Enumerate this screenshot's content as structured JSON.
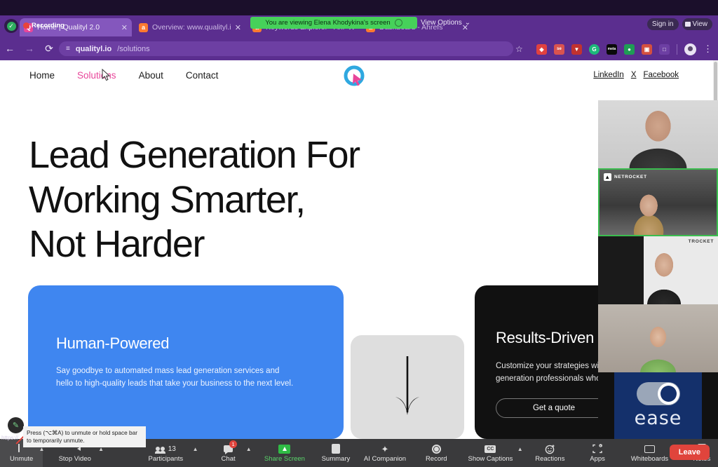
{
  "browser": {
    "recording_label": "Recording",
    "signin_label": "Sign in",
    "view_label": "View",
    "tabs": [
      {
        "title": "Home | Qualityl 2.0",
        "favicon": "Q",
        "favicon_color": "#e8469a",
        "active": true
      },
      {
        "title": "Overview: www.qualityl.io/ - Ah",
        "favicon": "a",
        "favicon_color": "#ff7a2f",
        "active": false
      },
      {
        "title": "Keywords Explorer - Ahrefs",
        "favicon": "a",
        "favicon_color": "#ff7a2f",
        "active": false
      },
      {
        "title": "Dashboard - Ahrefs",
        "favicon": "a",
        "favicon_color": "#ff7a2f",
        "active": false
      }
    ],
    "new_tab_glyph": "+",
    "close_glyph": "✕",
    "back_glyph": "←",
    "forward_glyph": "→",
    "reload_glyph": "⟳",
    "url_host": "qualityl.io",
    "url_path": "/solutions",
    "star_glyph": "☆",
    "kebab_glyph": "⋮",
    "extensions": [
      {
        "name": "diamond-extension-icon",
        "glyph": "◆",
        "color": "#e0413f"
      },
      {
        "name": "seo-extension-icon",
        "glyph": "se",
        "color": "#d9534f"
      },
      {
        "name": "shield-extension-icon",
        "glyph": "▼",
        "color": "#c2322f"
      },
      {
        "name": "grammarly-extension-icon",
        "glyph": "G",
        "color": "#1db87a"
      },
      {
        "name": "meta-extension-icon",
        "glyph": "meta",
        "color": "#0a0a0a"
      },
      {
        "name": "clip-extension-icon",
        "glyph": "●",
        "color": "#1f9d55"
      },
      {
        "name": "gallery-extension-icon",
        "glyph": "▣",
        "color": "#d4503f"
      },
      {
        "name": "bag-extension-icon",
        "glyph": "□",
        "color": "#6d3fa3"
      }
    ]
  },
  "share_banner": {
    "text": "You are viewing Elena Khodykina's screen",
    "view_options_label": "View Options",
    "chevron": "⌄"
  },
  "site": {
    "nav": [
      {
        "label": "Home",
        "active": false
      },
      {
        "label": "Solutions",
        "active": true
      },
      {
        "label": "About",
        "active": false
      },
      {
        "label": "Contact",
        "active": false
      }
    ],
    "social": [
      "LinkedIn",
      "X",
      "Facebook"
    ],
    "hero": {
      "line1": "Lead Generation For",
      "line2": "Working Smarter,",
      "line3": "Not Harder"
    },
    "cards": {
      "blue": {
        "title": "Human-Powered",
        "body_line1": "Say goodbye to automated mass lead generation services and",
        "body_line2": "hello to high-quality leads that take your business to the next level.",
        "color": "#3f86f0"
      },
      "grey": {
        "arrow_glyph": "↓",
        "color": "#dedede"
      },
      "dark": {
        "title": "Results-Driven",
        "body_line1": "Customize your strategies with a",
        "body_line2": "generation professionals who bri",
        "button_label": "Get a quote",
        "color": "#111111"
      }
    }
  },
  "zoom_call": {
    "tiles": [
      {
        "name": "participant-tile-1",
        "badge": ""
      },
      {
        "name": "participant-tile-2",
        "badge": "NETROCKET",
        "speaking": true
      },
      {
        "name": "participant-tile-3",
        "badge": "TROCKET"
      },
      {
        "name": "participant-tile-4",
        "badge": ""
      },
      {
        "name": "participant-tile-5",
        "badge": "ease"
      }
    ],
    "brand_tile_text": "ease",
    "toolbar": [
      {
        "name": "unmute-button",
        "label": "Unmute",
        "icon": "mic-muted-icon",
        "caret": true,
        "highlight": true
      },
      {
        "name": "stop-video-button",
        "label": "Stop Video",
        "icon": "camera-icon",
        "caret": true
      },
      {
        "name": "participants-button",
        "label": "Participants",
        "icon": "people-icon",
        "count": "13",
        "caret": true
      },
      {
        "name": "chat-button",
        "label": "Chat",
        "icon": "chat-bubble-icon",
        "badge": "1",
        "caret": true
      },
      {
        "name": "share-screen-button",
        "label": "Share Screen",
        "icon": "share-screen-icon",
        "green": true
      },
      {
        "name": "summary-button",
        "label": "Summary",
        "icon": "document-icon"
      },
      {
        "name": "ai-companion-button",
        "label": "AI Companion",
        "icon": "sparkle-icon"
      },
      {
        "name": "record-button",
        "label": "Record",
        "icon": "record-circle-icon"
      },
      {
        "name": "show-captions-button",
        "label": "Show Captions",
        "icon": "cc-icon",
        "caret": true
      },
      {
        "name": "reactions-button",
        "label": "Reactions",
        "icon": "smiley-icon"
      },
      {
        "name": "apps-button",
        "label": "Apps",
        "icon": "apps-icon"
      },
      {
        "name": "whiteboards-button",
        "label": "Whiteboards",
        "icon": "whiteboard-icon"
      },
      {
        "name": "notes-button",
        "label": "Notes",
        "icon": "notes-icon"
      }
    ],
    "leave_label": "Leave",
    "tooltip": "Press (⌥⌘A) to unmute or hold space bar to temporarily unmute.",
    "annotate_glyph": "✎",
    "status_url": "https://"
  }
}
